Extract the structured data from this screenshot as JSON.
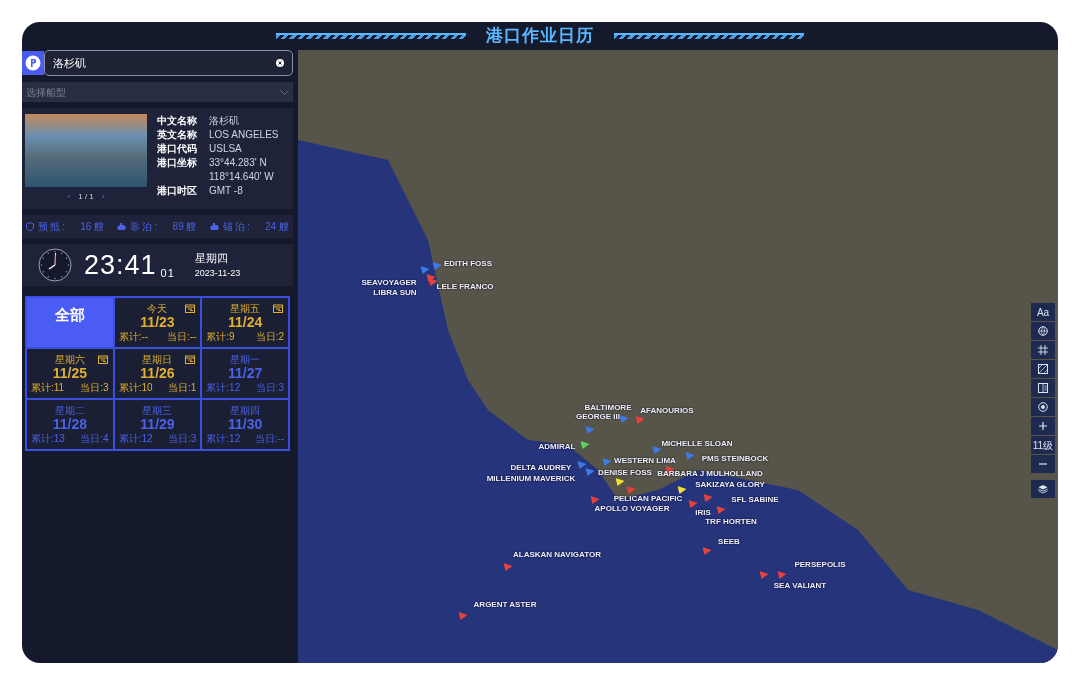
{
  "header": {
    "title": "港口作业日历"
  },
  "port_search": {
    "value": "洛杉矶"
  },
  "ship_type_select": {
    "placeholder": "选择船型"
  },
  "port_info": {
    "pager_prev": "‹",
    "pager": "1 / 1",
    "pager_next": "›",
    "fields": [
      {
        "label": "中文名称",
        "values": [
          "洛杉矶"
        ]
      },
      {
        "label": "英文名称",
        "values": [
          "LOS ANGELES"
        ]
      },
      {
        "label": "港口代码",
        "values": [
          "USLSA"
        ]
      },
      {
        "label": "港口坐标",
        "values": [
          "33°44.283' N",
          "118°14.640' W"
        ]
      },
      {
        "label": "港口时区",
        "values": [
          "GMT -8"
        ]
      }
    ]
  },
  "stats": [
    {
      "kind": "arriving",
      "label": "预抵:",
      "count": "16 艘"
    },
    {
      "kind": "berthed",
      "label": "靠泊:",
      "count": "89 艘"
    },
    {
      "kind": "anchored",
      "label": "锚泊:",
      "count": "24 艘"
    }
  ],
  "clock": {
    "time": "23:41",
    "seconds": "01",
    "weekday": "星期四",
    "date": "2023-11-23"
  },
  "calendar": [
    {
      "kind": "all",
      "label": "全部",
      "selected": true
    },
    {
      "kind": "day",
      "weekday": "今天",
      "date": "11/23",
      "total": "累计:--",
      "today": "当日:--",
      "has_plan": true,
      "selected": false
    },
    {
      "kind": "day",
      "weekday": "星期五",
      "date": "11/24",
      "total": "累计:9",
      "today": "当日:2",
      "has_plan": true,
      "selected": false
    },
    {
      "kind": "day",
      "weekday": "星期六",
      "date": "11/25",
      "total": "累计:11",
      "today": "当日:3",
      "has_plan": true,
      "selected": false
    },
    {
      "kind": "day",
      "weekday": "星期日",
      "date": "11/26",
      "total": "累计:10",
      "today": "当日:1",
      "has_plan": true,
      "selected": false
    },
    {
      "kind": "day",
      "weekday": "星期一",
      "date": "11/27",
      "total": "累计:12",
      "today": "当日:3",
      "has_plan": false,
      "selected": false
    },
    {
      "kind": "day",
      "weekday": "星期二",
      "date": "11/28",
      "total": "累计:13",
      "today": "当日:4",
      "has_plan": false,
      "selected": false
    },
    {
      "kind": "day",
      "weekday": "星期三",
      "date": "11/29",
      "total": "累计:12",
      "today": "当日:3",
      "has_plan": false,
      "selected": false
    },
    {
      "kind": "day",
      "weekday": "星期四",
      "date": "11/30",
      "total": "累计:12",
      "today": "当日:--",
      "has_plan": false,
      "selected": false
    }
  ],
  "map": {
    "ships": [
      {
        "name": "SEAVOYAGER",
        "color": "#3b7be8"
      },
      {
        "name": "LIBRA SUN",
        "color": "#e8413c"
      },
      {
        "name": "EDITH FOSS",
        "color": "#3b7be8"
      },
      {
        "name": "LELE FRANCO",
        "color": "#e8413c"
      },
      {
        "name": "BALTIMORE",
        "color": "#3b7be8"
      },
      {
        "name": "GEORGE III",
        "color": "#3b7be8"
      },
      {
        "name": "AFANOURIOS",
        "color": "#e8413c"
      },
      {
        "name": "ADMIRAL",
        "color": "#5fd35f"
      },
      {
        "name": "DELTA AUDREY",
        "color": "#3b7be8"
      },
      {
        "name": "MILLENIUM MAVERICK",
        "color": "#3b7be8"
      },
      {
        "name": "WESTERN LIMA",
        "color": "#3b7be8"
      },
      {
        "name": "MICHELLE SLOAN",
        "color": "#3b7be8"
      },
      {
        "name": "PMS STEINBOCK",
        "color": "#3b7be8"
      },
      {
        "name": "BARBARA J MULHOLLAND",
        "color": "#e8413c"
      },
      {
        "name": "SAKIZAYA GLORY",
        "color": "#f0e030"
      },
      {
        "name": "DENISE FOSS",
        "color": "#f0e030"
      },
      {
        "name": "PELICAN PACIFIC",
        "color": "#e8413c"
      },
      {
        "name": "APOLLO VOYAGER",
        "color": "#e8413c"
      },
      {
        "name": "IRIS",
        "color": "#e8413c"
      },
      {
        "name": "TRF HORTEN",
        "color": "#e8413c"
      },
      {
        "name": "SFL SABINE",
        "color": "#e8413c"
      },
      {
        "name": "SEEB",
        "color": "#e8413c"
      },
      {
        "name": "PERSEPOLIS",
        "color": "#e8413c"
      },
      {
        "name": "SEA VALIANT",
        "color": "#e8413c"
      },
      {
        "name": "ALASKAN NAVIGATOR",
        "color": "#e8413c"
      },
      {
        "name": "ARGENT ASTER",
        "color": "#e8413c"
      }
    ],
    "toolbar": [
      {
        "kind": "text",
        "label": "Aa"
      },
      {
        "kind": "globe"
      },
      {
        "kind": "grid"
      },
      {
        "kind": "hatch"
      },
      {
        "kind": "layout"
      },
      {
        "kind": "target"
      },
      {
        "kind": "zoom_in"
      },
      {
        "kind": "level",
        "label": "11级"
      },
      {
        "kind": "zoom_out"
      },
      {
        "kind": "layers"
      }
    ]
  }
}
